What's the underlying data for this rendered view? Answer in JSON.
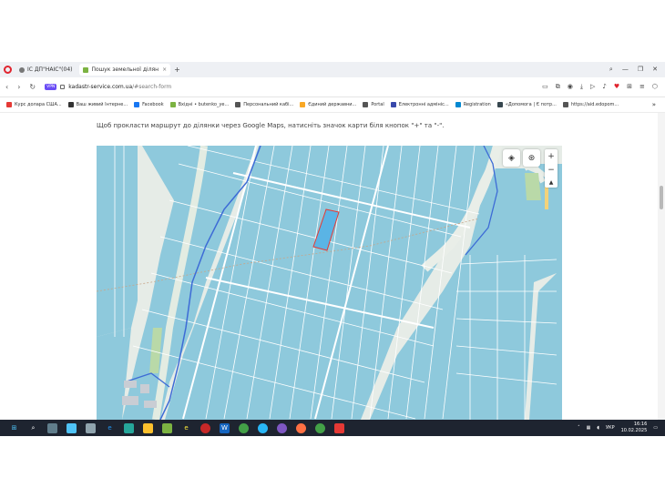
{
  "browser": {
    "tabs": [
      {
        "label": "ІС ДП\"НАІС\"(04)",
        "active": false
      },
      {
        "label": "Пошук земельної ділян",
        "active": true
      }
    ],
    "new_tab": "+",
    "address": {
      "vpn_label": "VPN",
      "domain": "kadastr-service.com.ua",
      "path": "/#search-form"
    }
  },
  "bookmarks": [
    {
      "label": "Курс долара США...",
      "icon": "m-icon",
      "color": "#e53935"
    },
    {
      "label": "Ваш живий Інтерне...",
      "icon": "globe-icon",
      "color": "#333333"
    },
    {
      "label": "Facebook",
      "icon": "facebook-icon",
      "color": "#1877f2"
    },
    {
      "label": "Вхідні • butenko_ye...",
      "icon": "mail-icon",
      "color": "#7cb342"
    },
    {
      "label": "Персональний кабі...",
      "icon": "person-icon",
      "color": "#555555"
    },
    {
      "label": "Єдиний державни...",
      "icon": "trident-icon",
      "color": "#f9a825"
    },
    {
      "label": "Portal",
      "icon": "page-icon",
      "color": "#555555"
    },
    {
      "label": "Електронні адмініс...",
      "icon": "admin-icon",
      "color": "#3949ab"
    },
    {
      "label": "Registration",
      "icon": "registration-icon",
      "color": "#0288d1"
    },
    {
      "label": "«Допомога | Є потр...",
      "icon": "help-icon",
      "color": "#37474f"
    },
    {
      "label": "https://aid.edopom...",
      "icon": "shield-icon",
      "color": "#555555"
    }
  ],
  "page": {
    "instruction": "Щоб прокласти маршрут до ділянки через Google Maps, натисніть значок карти біля кнопок \"+\" та \"-\"."
  },
  "map": {
    "controls": {
      "zoom_in": "+",
      "zoom_out": "−",
      "compass": "▲"
    },
    "parcel_color": "#8ec9dc",
    "selected_parcel_color": "#5ab4e5",
    "selected_border": "#e53935",
    "boundary_color": "#3d6bd6"
  },
  "taskbar": {
    "language": "УКР",
    "time": "16:16",
    "date": "10.02.2025"
  }
}
